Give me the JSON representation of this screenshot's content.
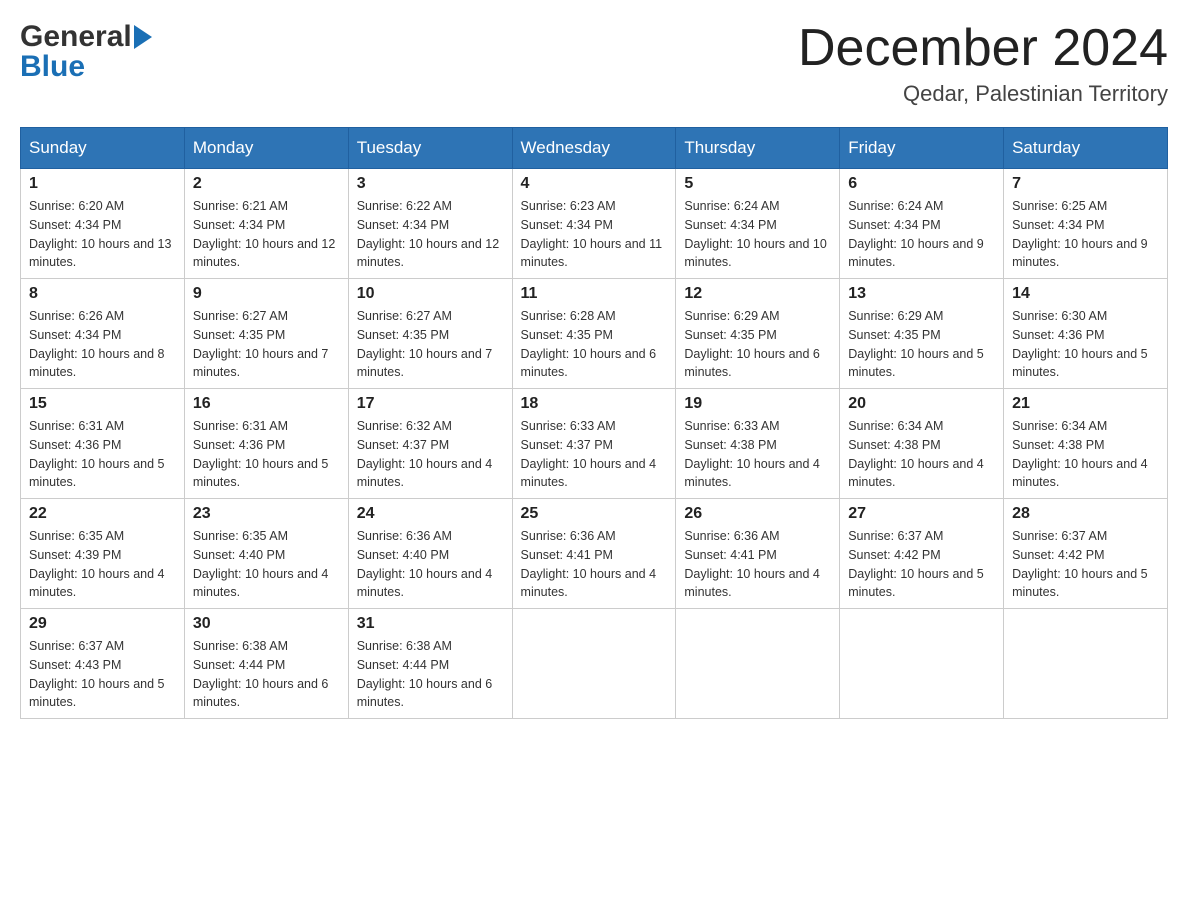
{
  "header": {
    "logo_general": "General",
    "logo_blue": "Blue",
    "month_title": "December 2024",
    "location": "Qedar, Palestinian Territory"
  },
  "days_of_week": [
    "Sunday",
    "Monday",
    "Tuesday",
    "Wednesday",
    "Thursday",
    "Friday",
    "Saturday"
  ],
  "weeks": [
    [
      {
        "day": "1",
        "sunrise": "6:20 AM",
        "sunset": "4:34 PM",
        "daylight": "10 hours and 13 minutes."
      },
      {
        "day": "2",
        "sunrise": "6:21 AM",
        "sunset": "4:34 PM",
        "daylight": "10 hours and 12 minutes."
      },
      {
        "day": "3",
        "sunrise": "6:22 AM",
        "sunset": "4:34 PM",
        "daylight": "10 hours and 12 minutes."
      },
      {
        "day": "4",
        "sunrise": "6:23 AM",
        "sunset": "4:34 PM",
        "daylight": "10 hours and 11 minutes."
      },
      {
        "day": "5",
        "sunrise": "6:24 AM",
        "sunset": "4:34 PM",
        "daylight": "10 hours and 10 minutes."
      },
      {
        "day": "6",
        "sunrise": "6:24 AM",
        "sunset": "4:34 PM",
        "daylight": "10 hours and 9 minutes."
      },
      {
        "day": "7",
        "sunrise": "6:25 AM",
        "sunset": "4:34 PM",
        "daylight": "10 hours and 9 minutes."
      }
    ],
    [
      {
        "day": "8",
        "sunrise": "6:26 AM",
        "sunset": "4:34 PM",
        "daylight": "10 hours and 8 minutes."
      },
      {
        "day": "9",
        "sunrise": "6:27 AM",
        "sunset": "4:35 PM",
        "daylight": "10 hours and 7 minutes."
      },
      {
        "day": "10",
        "sunrise": "6:27 AM",
        "sunset": "4:35 PM",
        "daylight": "10 hours and 7 minutes."
      },
      {
        "day": "11",
        "sunrise": "6:28 AM",
        "sunset": "4:35 PM",
        "daylight": "10 hours and 6 minutes."
      },
      {
        "day": "12",
        "sunrise": "6:29 AM",
        "sunset": "4:35 PM",
        "daylight": "10 hours and 6 minutes."
      },
      {
        "day": "13",
        "sunrise": "6:29 AM",
        "sunset": "4:35 PM",
        "daylight": "10 hours and 5 minutes."
      },
      {
        "day": "14",
        "sunrise": "6:30 AM",
        "sunset": "4:36 PM",
        "daylight": "10 hours and 5 minutes."
      }
    ],
    [
      {
        "day": "15",
        "sunrise": "6:31 AM",
        "sunset": "4:36 PM",
        "daylight": "10 hours and 5 minutes."
      },
      {
        "day": "16",
        "sunrise": "6:31 AM",
        "sunset": "4:36 PM",
        "daylight": "10 hours and 5 minutes."
      },
      {
        "day": "17",
        "sunrise": "6:32 AM",
        "sunset": "4:37 PM",
        "daylight": "10 hours and 4 minutes."
      },
      {
        "day": "18",
        "sunrise": "6:33 AM",
        "sunset": "4:37 PM",
        "daylight": "10 hours and 4 minutes."
      },
      {
        "day": "19",
        "sunrise": "6:33 AM",
        "sunset": "4:38 PM",
        "daylight": "10 hours and 4 minutes."
      },
      {
        "day": "20",
        "sunrise": "6:34 AM",
        "sunset": "4:38 PM",
        "daylight": "10 hours and 4 minutes."
      },
      {
        "day": "21",
        "sunrise": "6:34 AM",
        "sunset": "4:38 PM",
        "daylight": "10 hours and 4 minutes."
      }
    ],
    [
      {
        "day": "22",
        "sunrise": "6:35 AM",
        "sunset": "4:39 PM",
        "daylight": "10 hours and 4 minutes."
      },
      {
        "day": "23",
        "sunrise": "6:35 AM",
        "sunset": "4:40 PM",
        "daylight": "10 hours and 4 minutes."
      },
      {
        "day": "24",
        "sunrise": "6:36 AM",
        "sunset": "4:40 PM",
        "daylight": "10 hours and 4 minutes."
      },
      {
        "day": "25",
        "sunrise": "6:36 AM",
        "sunset": "4:41 PM",
        "daylight": "10 hours and 4 minutes."
      },
      {
        "day": "26",
        "sunrise": "6:36 AM",
        "sunset": "4:41 PM",
        "daylight": "10 hours and 4 minutes."
      },
      {
        "day": "27",
        "sunrise": "6:37 AM",
        "sunset": "4:42 PM",
        "daylight": "10 hours and 5 minutes."
      },
      {
        "day": "28",
        "sunrise": "6:37 AM",
        "sunset": "4:42 PM",
        "daylight": "10 hours and 5 minutes."
      }
    ],
    [
      {
        "day": "29",
        "sunrise": "6:37 AM",
        "sunset": "4:43 PM",
        "daylight": "10 hours and 5 minutes."
      },
      {
        "day": "30",
        "sunrise": "6:38 AM",
        "sunset": "4:44 PM",
        "daylight": "10 hours and 6 minutes."
      },
      {
        "day": "31",
        "sunrise": "6:38 AM",
        "sunset": "4:44 PM",
        "daylight": "10 hours and 6 minutes."
      },
      null,
      null,
      null,
      null
    ]
  ]
}
